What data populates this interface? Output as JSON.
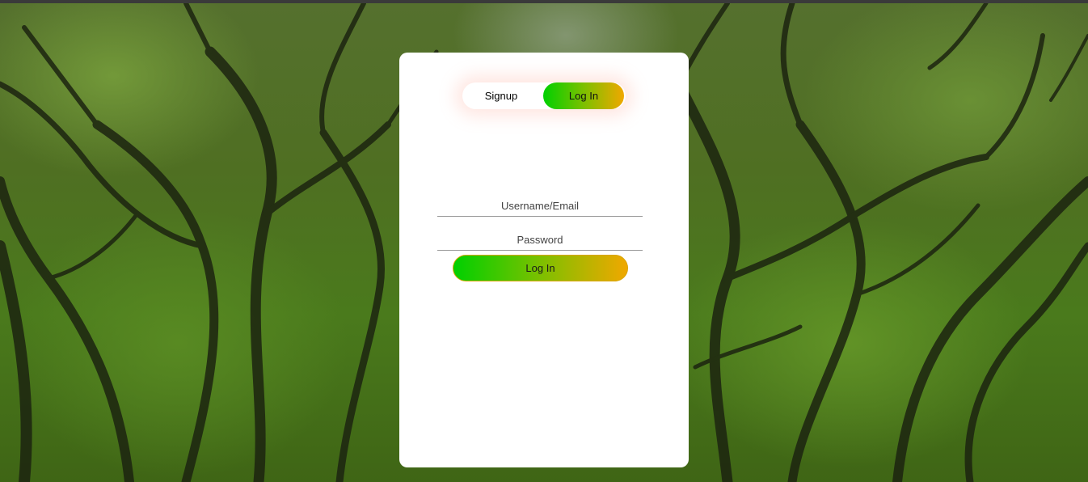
{
  "auth_toggle": {
    "signup_label": "Signup",
    "login_label": "Log In",
    "active_tab": "Log In"
  },
  "login_form": {
    "username_placeholder": "Username/Email",
    "username_value": "",
    "password_placeholder": "Password",
    "password_value": "",
    "submit_label": "Log In"
  },
  "colors": {
    "gradient_start": "#00d000",
    "gradient_mid": "#7cc000",
    "gradient_end": "#f0a800",
    "card_background": "#ffffff",
    "background_theme": "#4a7a1c"
  },
  "background": {
    "image": "forest-canopy-photo"
  }
}
